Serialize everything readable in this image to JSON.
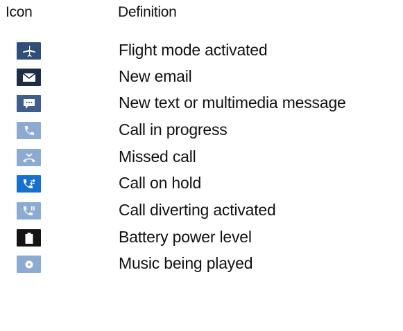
{
  "header": {
    "icon_col": "Icon",
    "definition_col": "Definition"
  },
  "colors": {
    "navy": "#2f4f78",
    "dark_navy": "#1e2d46",
    "steel": "#3f5e8c",
    "light_blue": "#8cabd3",
    "bright_blue": "#1570cf",
    "black": "#141414",
    "glyph": "#ffffff"
  },
  "rows": [
    {
      "icon": "airplane-icon",
      "definition": "Flight mode activated"
    },
    {
      "icon": "envelope-icon",
      "definition": "New email"
    },
    {
      "icon": "message-bubble-icon",
      "definition": "New text or multimedia message"
    },
    {
      "icon": "phone-handset-icon",
      "definition": "Call in progress"
    },
    {
      "icon": "missed-call-icon",
      "definition": "Missed call"
    },
    {
      "icon": "call-on-hold-icon",
      "definition": "Call on hold"
    },
    {
      "icon": "call-divert-icon",
      "definition": "Call diverting activated"
    },
    {
      "icon": "battery-icon",
      "definition": "Battery power level"
    },
    {
      "icon": "music-disc-icon",
      "definition": "Music being played"
    }
  ]
}
